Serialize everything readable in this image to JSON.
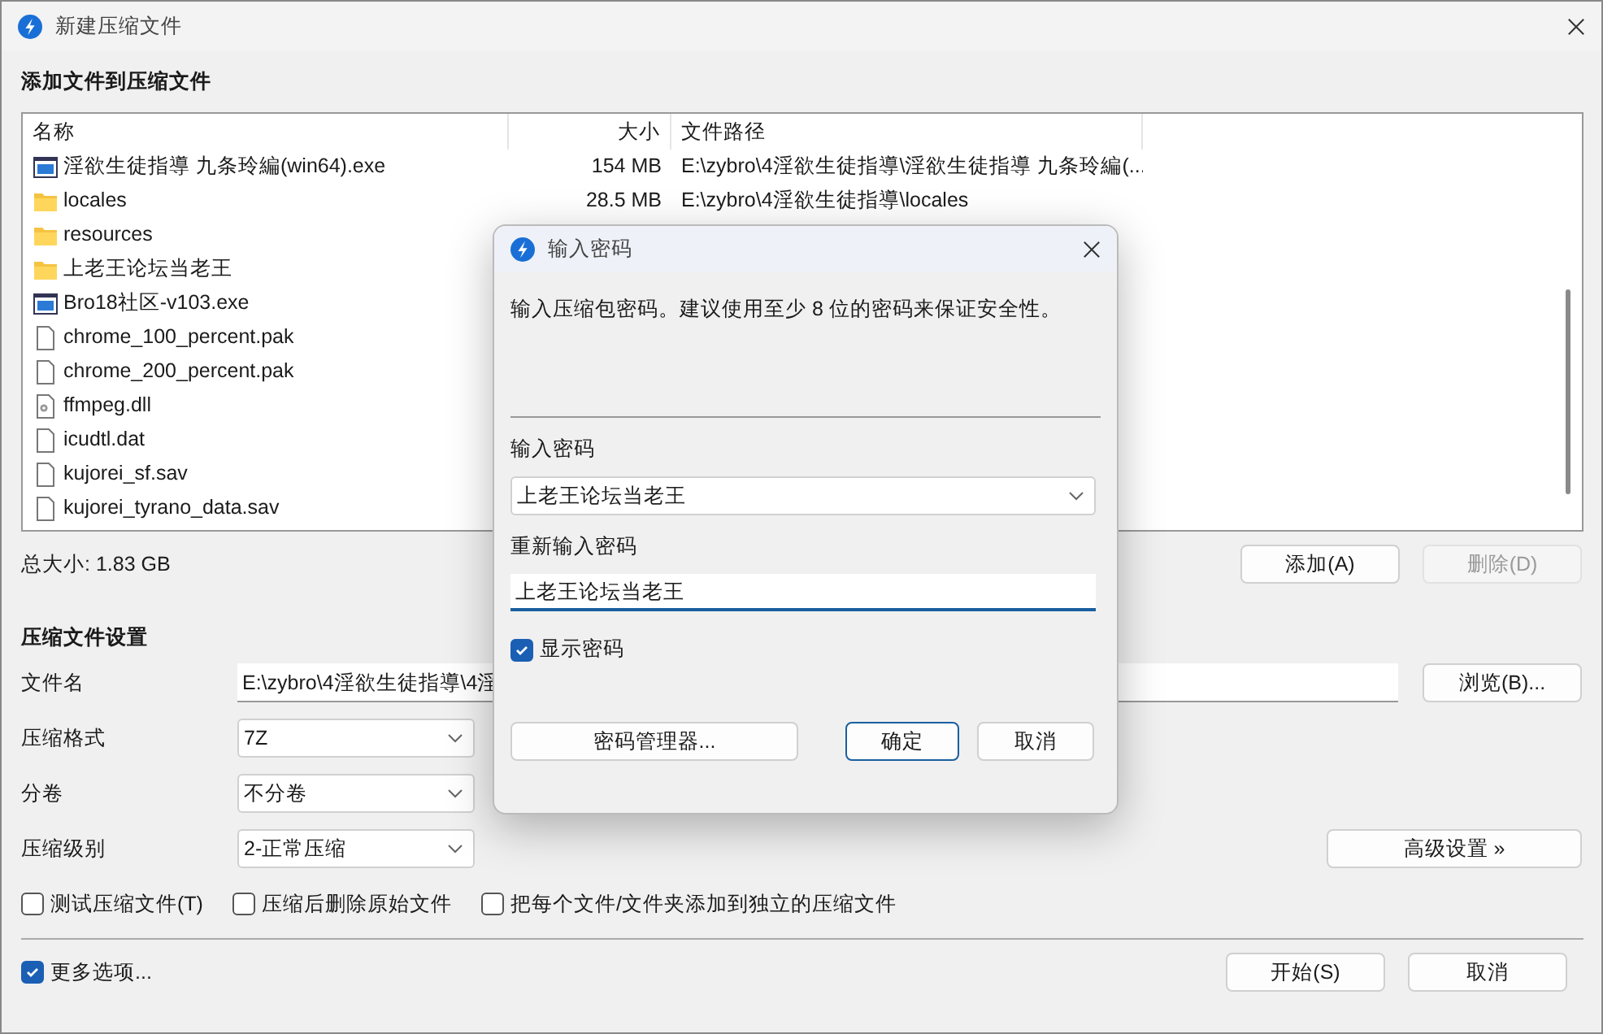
{
  "window": {
    "title": "新建压缩文件"
  },
  "add_section": {
    "heading": "添加文件到压缩文件"
  },
  "file_list": {
    "columns": [
      "名称",
      "大小",
      "文件路径"
    ],
    "rows": [
      {
        "kind": "exe",
        "name": "淫欲生徒指導 九条玲編(win64).exe",
        "size": "154 MB",
        "path": "E:\\zybro\\4淫欲生徒指導\\淫欲生徒指導 九条玲編(..."
      },
      {
        "kind": "folder",
        "name": "locales",
        "size": "28.5 MB",
        "path": "E:\\zybro\\4淫欲生徒指導\\locales"
      },
      {
        "kind": "folder",
        "name": "resources"
      },
      {
        "kind": "folder",
        "name": "上老王论坛当老王"
      },
      {
        "kind": "exe",
        "name": "Bro18社区-v103.exe"
      },
      {
        "kind": "file",
        "name": "chrome_100_percent.pak"
      },
      {
        "kind": "file",
        "name": "chrome_200_percent.pak"
      },
      {
        "kind": "dll",
        "name": "ffmpeg.dll"
      },
      {
        "kind": "file",
        "name": "icudtl.dat"
      },
      {
        "kind": "file",
        "name": "kujorei_sf.sav"
      },
      {
        "kind": "file",
        "name": "kujorei_tyrano_data.sav"
      }
    ]
  },
  "total_size": "总大小: 1.83 GB",
  "list_buttons": [
    {
      "label": "添加(A)",
      "disabled": false
    },
    {
      "label": "删除(D)",
      "disabled": true
    }
  ],
  "settings": {
    "heading": "压缩文件设置",
    "fields": [
      {
        "kind": "text",
        "label": "文件名",
        "value": "E:\\zybro\\4淫欲生徒指導\\4淫"
      },
      {
        "kind": "select",
        "label": "压缩格式",
        "value": "7Z"
      },
      {
        "kind": "select",
        "label": "分卷",
        "value": "不分卷"
      },
      {
        "kind": "select",
        "label": "压缩级别",
        "value": "2-正常压缩"
      }
    ],
    "browse_button": "浏览(B)...",
    "advanced_button": "高级设置 »",
    "options": [
      {
        "label": "测试压缩文件(T)",
        "checked": false
      },
      {
        "label": "压缩后删除原始文件",
        "checked": false
      },
      {
        "label": "把每个文件/文件夹添加到独立的压缩文件",
        "checked": false
      }
    ]
  },
  "footer": {
    "more_options": {
      "label": "更多选项...",
      "checked": true
    },
    "buttons": [
      "开始(S)",
      "取消"
    ]
  },
  "dialog": {
    "title": "输入密码",
    "description": "输入压缩包密码。建议使用至少 8 位的密码来保证安全性。",
    "password_label": "输入密码",
    "password_value": "上老王论坛当老王",
    "confirm_label": "重新输入密码",
    "confirm_value": "上老王论坛当老王",
    "show_password": {
      "label": "显示密码",
      "checked": true
    },
    "buttons": [
      {
        "label": "密码管理器...",
        "default": false
      },
      {
        "label": "确定",
        "default": true
      },
      {
        "label": "取消",
        "default": false
      }
    ]
  }
}
